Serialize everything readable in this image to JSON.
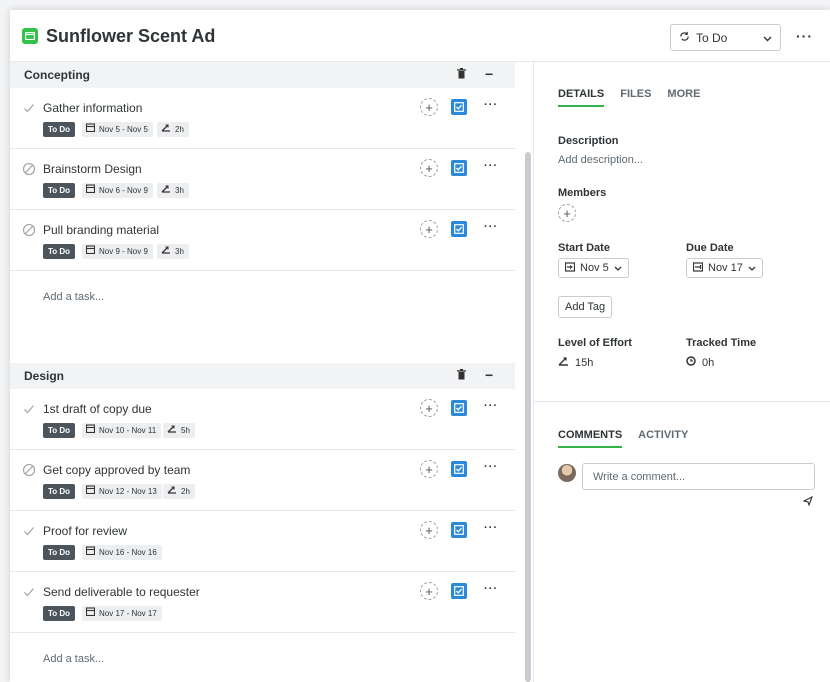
{
  "header": {
    "title": "Sunflower Scent Ad",
    "status": "To Do",
    "more": "···"
  },
  "sections": [
    {
      "name": "Concepting",
      "tasks": [
        {
          "name": "Gather information",
          "status": "To Do",
          "dates": "Nov 5 - Nov 5",
          "effort": "2h",
          "check": "done"
        },
        {
          "name": "Brainstorm Design",
          "status": "To Do",
          "dates": "Nov 6 - Nov 9",
          "effort": "3h",
          "check": "blocked"
        },
        {
          "name": "Pull branding material",
          "status": "To Do",
          "dates": "Nov 9 - Nov 9",
          "effort": "3h",
          "check": "blocked"
        }
      ],
      "add_task": "Add a task..."
    },
    {
      "name": "Design",
      "tasks": [
        {
          "name": "1st draft of copy due",
          "status": "To Do",
          "dates": "Nov 10 - Nov 11",
          "effort": "5h",
          "check": "done"
        },
        {
          "name": "Get copy approved by team",
          "status": "To Do",
          "dates": "Nov 12 - Nov 13",
          "effort": "2h",
          "check": "blocked"
        },
        {
          "name": "Proof for review",
          "status": "To Do",
          "dates": "Nov 16 - Nov 16",
          "effort": "",
          "check": "done"
        },
        {
          "name": "Send deliverable to requester",
          "status": "To Do",
          "dates": "Nov 17 - Nov 17",
          "effort": "",
          "check": "done"
        }
      ],
      "add_task": "Add a task..."
    }
  ],
  "details": {
    "tabs": [
      "DETAILS",
      "FILES",
      "MORE"
    ],
    "description_label": "Description",
    "description_placeholder": "Add description...",
    "members_label": "Members",
    "start_date_label": "Start Date",
    "start_date": "Nov 5",
    "due_date_label": "Due Date",
    "due_date": "Nov 17",
    "add_tag": "Add Tag",
    "effort_label": "Level of Effort",
    "effort": "15h",
    "tracked_label": "Tracked Time",
    "tracked": "0h"
  },
  "comments": {
    "tabs": [
      "COMMENTS",
      "ACTIVITY"
    ],
    "placeholder": "Write a comment..."
  },
  "colors": {
    "accent_green": "#34b24a",
    "project_icon": "#34c24a",
    "complete_blue": "#2b8ad8",
    "todo_badge": "#4d555c"
  }
}
